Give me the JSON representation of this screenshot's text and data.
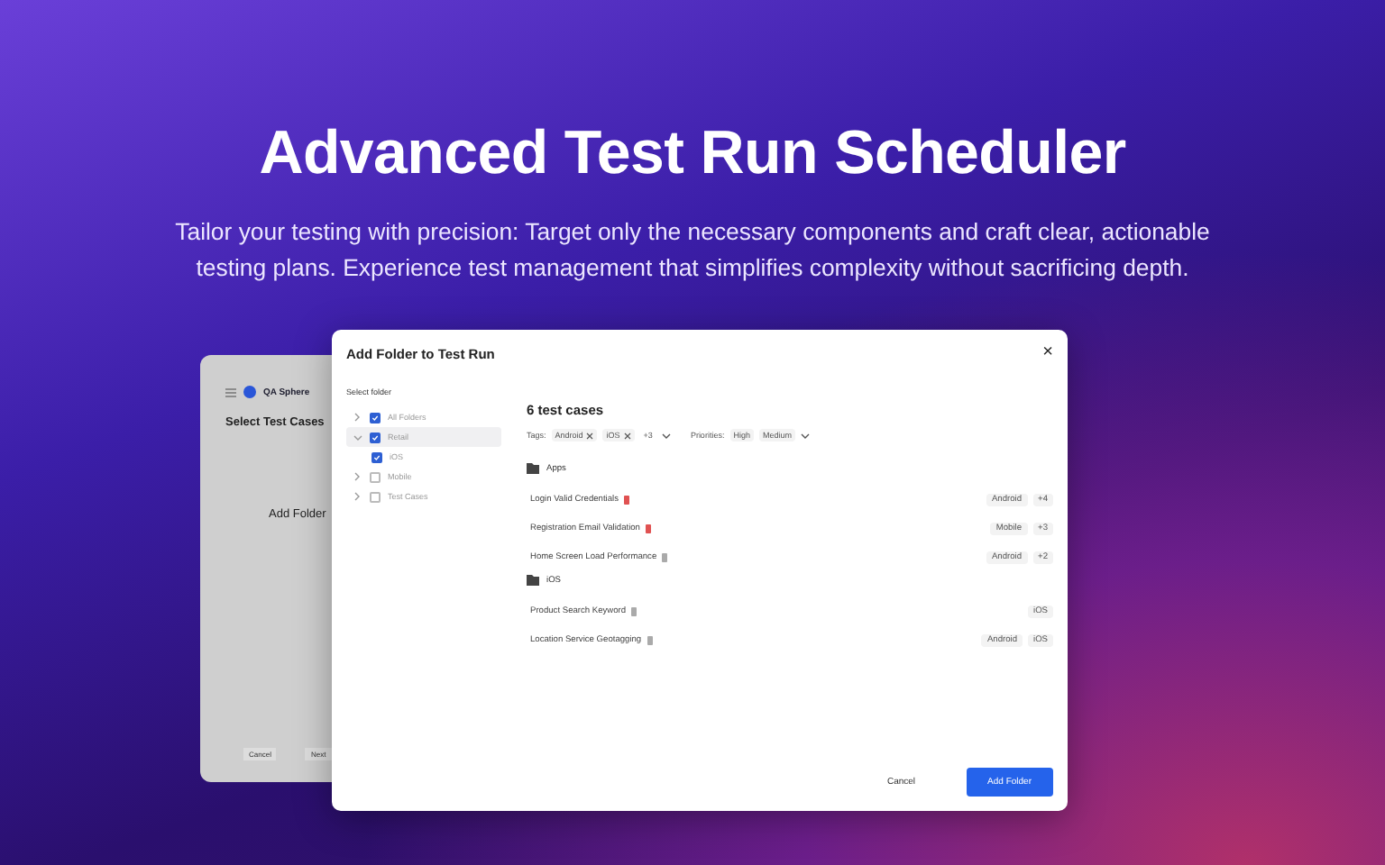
{
  "hero": {
    "title": "Advanced Test Run Scheduler",
    "subtitle": "Tailor your testing with precision: Target only the necessary components and craft clear, actionable testing plans. Experience test management that simplifies complexity without sacrificing depth."
  },
  "back_window": {
    "logo": "QA Sphere",
    "title": "Select Test Cases",
    "heading": "Add Folder",
    "buttons": [
      "Cancel",
      "Next"
    ]
  },
  "dialog": {
    "title": "Add Folder to Test Run",
    "close": "×",
    "folder_label": "Select folder",
    "folders": [
      {
        "label": "All Folders",
        "checked": true,
        "selected": false,
        "expanded": false
      },
      {
        "label": "Retail",
        "checked": true,
        "selected": true,
        "expanded": true,
        "children": [
          {
            "label": "iOS",
            "checked": true,
            "selected": false
          }
        ]
      },
      {
        "label": "Mobile",
        "checked": false,
        "selected": false,
        "expanded": false
      },
      {
        "label": "Test Cases",
        "checked": false,
        "selected": false,
        "expanded": false
      }
    ],
    "count": "6 test cases",
    "tags_label": "Tags:",
    "tags": [
      "Android",
      "iOS"
    ],
    "tags_more": "+3",
    "priorities_label": "Priorities:",
    "priorities": [
      "High",
      "Medium"
    ],
    "groups": [
      {
        "name": "Apps",
        "cases": [
          {
            "name": "Login Valid Credentials",
            "color": "#e05252",
            "tags": [
              "Android",
              "+4"
            ]
          },
          {
            "name": "Registration Email Validation",
            "color": "#e05252",
            "tags": [
              "Mobile",
              "+3"
            ]
          },
          {
            "name": "Home Screen Load Performance",
            "color": "#aaaaaa",
            "tags": [
              "Android",
              "+2"
            ]
          }
        ]
      },
      {
        "name": "iOS",
        "cases": [
          {
            "name": "Product Search Keyword",
            "color": "#aaaaaa",
            "tags": [
              "iOS"
            ]
          },
          {
            "name": "Location Service Geotagging",
            "color": "#aaaaaa",
            "tags": [
              "Android",
              "iOS"
            ]
          }
        ]
      }
    ],
    "buttons": [
      {
        "label": "Cancel",
        "kind": "secondary"
      },
      {
        "label": "Add Folder",
        "kind": "primary"
      }
    ]
  }
}
